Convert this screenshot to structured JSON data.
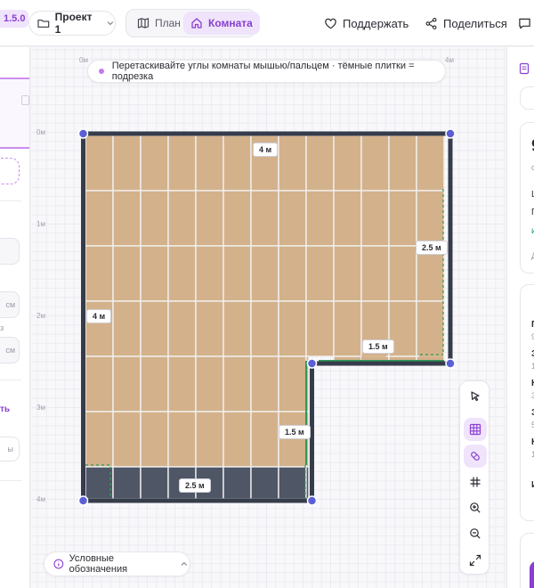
{
  "app": {
    "version": "1.5.0",
    "accent_color": "#8a3fd1"
  },
  "header": {
    "project": "Проект 1",
    "tabs": [
      {
        "label": "План",
        "active": false
      },
      {
        "label": "Комната",
        "active": true
      }
    ],
    "support_label": "Поддержать",
    "share_label": "Поделиться"
  },
  "canvas": {
    "hint": "Перетаскивайте углы комнаты мышью/пальцем · тёмные плитки = подрезка",
    "x_axis": [
      "0м",
      "4м"
    ],
    "y_axis": [
      "0м",
      "1м",
      "2м",
      "3м",
      "4м"
    ],
    "dimensions": {
      "top": "4 м",
      "left": "4 м",
      "right_upper": "2.5 м",
      "notch_horizontal": "1.5 м",
      "notch_vertical": "1.5 м",
      "bottom": "2.5 м"
    },
    "tile_color": "#d3b18b",
    "cut_tile_color": "#4f5666"
  },
  "tools": [
    "select-icon",
    "tiles-icon",
    "paint-icon",
    "grid-icon",
    "zoom-in-icon",
    "zoom-out-icon",
    "fit-icon"
  ],
  "legend": {
    "label": "Условные обозначения"
  },
  "left_panel": {
    "unit_1": "см",
    "unit_2": "см",
    "letter": "з",
    "accent": "ть",
    "button": "ы"
  },
  "right_panel": {
    "big": "9",
    "small_1": "с",
    "line_1": "L",
    "line_2": "П",
    "green": "и",
    "muted": "Д",
    "list": [
      {
        "label": "П",
        "sub": "9"
      },
      {
        "label": "З",
        "sub": "1"
      },
      {
        "label": "К",
        "sub": "3"
      },
      {
        "label": "З",
        "sub": "5"
      },
      {
        "label": "К",
        "sub": "1"
      }
    ],
    "total": "И"
  }
}
